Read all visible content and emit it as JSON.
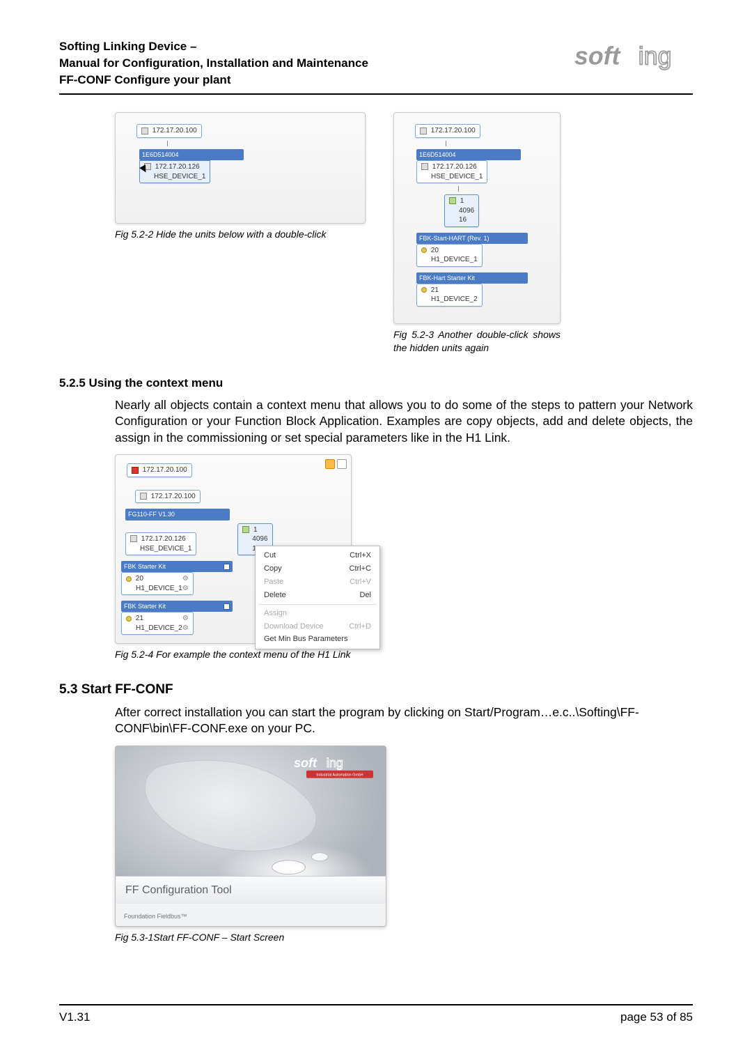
{
  "header": {
    "line1": "Softing Linking Device –",
    "line2": "Manual for Configuration, Installation and Maintenance",
    "line3": "FF-CONF Configure your plant"
  },
  "logo_text": "softing",
  "fig52_2": {
    "tree": {
      "root_ip": "172.17.20.100",
      "group_label": "1E6D514004",
      "device_ip": "172.17.20.126",
      "device_name": "HSE_DEVICE_1"
    },
    "caption": "Fig 5.2-2  Hide the units below with a double-click"
  },
  "fig52_3": {
    "tree": {
      "root_ip": "172.17.20.100",
      "group_label": "1E6D514004",
      "device_ip": "172.17.20.126",
      "device_name": "HSE_DEVICE_1",
      "link_vals": [
        "1",
        "4096",
        "16"
      ],
      "hdr1": "FBK-Start-HART (Rev. 1)",
      "dev1_addr": "20",
      "dev1_name": "H1_DEVICE_1",
      "hdr2": "FBK-Hart Starter Kit",
      "dev2_addr": "21",
      "dev2_name": "H1_DEVICE_2"
    },
    "caption": "Fig 5.2-3  Another double-click shows the hidden units again"
  },
  "section_525": {
    "heading": "5.2.5  Using the context menu",
    "body": "Nearly all objects contain a context menu that allows you to do some of the steps to pattern your Network Configuration or your Function Block Application. Examples are copy objects, add and delete objects, the assign in the commissioning or set special parameters like in the H1 Link."
  },
  "fig52_4": {
    "tree": {
      "top_ip": "172.17.20.100",
      "root_ip": "172.17.20.100",
      "group_label": "FG110-FF V1.30",
      "device_ip": "172.17.20.126",
      "device_name": "HSE_DEVICE_1",
      "link_vals": [
        "1",
        "4096",
        "16"
      ],
      "hdr1": "FBK Starter Kit",
      "dev1_addr": "20",
      "dev1_name": "H1_DEVICE_1",
      "hdr2": "FBK Starter Kit",
      "dev2_addr": "21",
      "dev2_name": "H1_DEVICE_2"
    },
    "context_menu": [
      {
        "label": "Cut",
        "shortcut": "Ctrl+X",
        "enabled": true
      },
      {
        "label": "Copy",
        "shortcut": "Ctrl+C",
        "enabled": true
      },
      {
        "label": "Paste",
        "shortcut": "Ctrl+V",
        "enabled": false
      },
      {
        "label": "Delete",
        "shortcut": "Del",
        "enabled": true
      },
      {
        "label": "Assign",
        "shortcut": "",
        "enabled": false
      },
      {
        "label": "Download Device",
        "shortcut": "Ctrl+D",
        "enabled": false
      },
      {
        "label": "Get Min Bus Parameters",
        "shortcut": "",
        "enabled": true
      }
    ],
    "caption": "Fig 5.2-4  For example the context menu of the H1 Link"
  },
  "section_53": {
    "heading": "5.3  Start FF-CONF",
    "body": "After correct installation you can start the program by clicking on Start/Program…e.c..\\Softing\\FF-CONF\\bin\\FF-CONF.exe on your PC."
  },
  "fig53_1": {
    "splash_subtitle": "Industrial Automation GmbH",
    "splash_bar_text": "FF Configuration Tool",
    "splash_footer_text": "Foundation Fieldbus™",
    "caption": "Fig 5.3-1Start FF-CONF – Start Screen"
  },
  "footer": {
    "version": "V1.31",
    "page": "page 53 of 85"
  }
}
